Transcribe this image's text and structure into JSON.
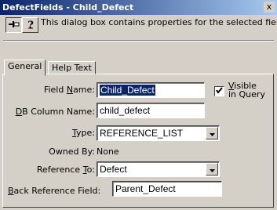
{
  "window": {
    "title": "DefectFields - Child_Defect",
    "close_glyph": "x"
  },
  "toolbar": {
    "pin_icon": "pin-icon",
    "help_icon": "help-icon",
    "info_text": "This dialog box contains properties for the selected field ."
  },
  "tabs": [
    {
      "label": "General",
      "active": true
    },
    {
      "label": "Help Text",
      "active": false
    }
  ],
  "form": {
    "field_name": {
      "label_pre": "Field ",
      "label_u": "N",
      "label_post": "ame:",
      "value": "Child_Defect"
    },
    "visible_in_query": {
      "label_u": "V",
      "label_post": "isible",
      "label_line2": "in Query",
      "checked": true
    },
    "db_column": {
      "label_u": "D",
      "label_post": "B Column Name:",
      "value": "child_defect"
    },
    "type": {
      "label_u": "T",
      "label_post": "ype:",
      "value": "REFERENCE_LIST"
    },
    "owned_by": {
      "label": "Owned By:",
      "value": "None"
    },
    "reference_to": {
      "label_pre": "Reference ",
      "label_u": "T",
      "label_post": "o:",
      "value": "Defect"
    },
    "back_reference": {
      "label_u": "B",
      "label_post": "ack Reference Field:",
      "value": "Parent_Defect"
    }
  },
  "colors": {
    "title_start": "#0a246a",
    "title_end": "#a6caf0",
    "face": "#d4d0c8",
    "selection": "#0a246a"
  }
}
